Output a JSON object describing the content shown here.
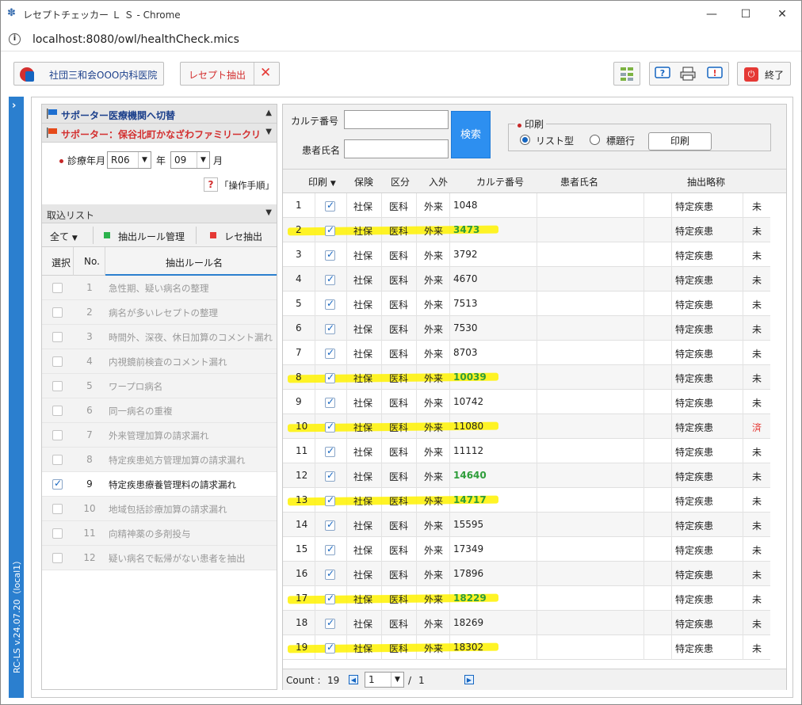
{
  "window": {
    "title": "レセプトチェッカー Ｌ Ｓ - Chrome",
    "url": "localhost:8080/owl/healthCheck.mics",
    "minimize": "—",
    "maximize": "☐",
    "close": "✕"
  },
  "toolbar": {
    "clinic_label": "社団三和会OOO内科医院",
    "extract_label": "レセプト抽出",
    "end_label": "終了"
  },
  "sidebar": {
    "version": "RC-LS v.24.07.20（local1）"
  },
  "left": {
    "supporter_switch": "サポーター医療機関へ切替",
    "supporter_name": "サポーター：保谷北町かなざわファミリークリ",
    "date_label": "診療年月",
    "year_value": "R06",
    "year_unit": "年",
    "month_value": "09",
    "month_unit": "月",
    "help_label": "「操作手順」",
    "import_list": "取込リスト",
    "all_label": "全て",
    "rule_manage": "抽出ルール管理",
    "rece_extract": "レセ抽出",
    "col_select": "選択",
    "col_no": "No.",
    "col_rule": "抽出ルール名",
    "rules": [
      {
        "no": "1",
        "name": "急性期、疑い病名の整理",
        "checked": false
      },
      {
        "no": "2",
        "name": "病名が多いレセプトの整理",
        "checked": false
      },
      {
        "no": "3",
        "name": "時間外、深夜、休日加算のコメント漏れ",
        "checked": false
      },
      {
        "no": "4",
        "name": "内視鏡前検査のコメント漏れ",
        "checked": false
      },
      {
        "no": "5",
        "name": "ワープロ病名",
        "checked": false
      },
      {
        "no": "6",
        "name": "同一病名の重複",
        "checked": false
      },
      {
        "no": "7",
        "name": "外来管理加算の請求漏れ",
        "checked": false
      },
      {
        "no": "8",
        "name": "特定疾患処方管理加算の請求漏れ",
        "checked": false
      },
      {
        "no": "9",
        "name": "特定疾患療養管理料の請求漏れ",
        "checked": true
      },
      {
        "no": "10",
        "name": "地域包括診療加算の請求漏れ",
        "checked": false
      },
      {
        "no": "11",
        "name": "向精神薬の多剤投与",
        "checked": false
      },
      {
        "no": "12",
        "name": "疑い病名で転帰がない患者を抽出",
        "checked": false
      }
    ]
  },
  "search": {
    "karte_label": "カルテ番号",
    "name_label": "患者氏名",
    "search_button": "検索",
    "print_legend": "印刷",
    "radio_list": "リスト型",
    "radio_title": "標題行",
    "print_button": "印刷"
  },
  "grid": {
    "headers": {
      "print": "印刷",
      "insurance": "保険",
      "category": "区分",
      "inout": "入外",
      "karte": "カルテ番号",
      "patient": "患者氏名",
      "summary": "抽出略称"
    },
    "rows": [
      {
        "idx": "1",
        "ins": "社保",
        "cat": "医科",
        "io": "外来",
        "karte": "1048",
        "summary": "特定疾患",
        "status": "未",
        "hl": false,
        "green": false,
        "red": false
      },
      {
        "idx": "2",
        "ins": "社保",
        "cat": "医科",
        "io": "外来",
        "karte": "3473",
        "summary": "特定疾患",
        "status": "未",
        "hl": true,
        "green": true,
        "red": false
      },
      {
        "idx": "3",
        "ins": "社保",
        "cat": "医科",
        "io": "外来",
        "karte": "3792",
        "summary": "特定疾患",
        "status": "未",
        "hl": false,
        "green": false,
        "red": false
      },
      {
        "idx": "4",
        "ins": "社保",
        "cat": "医科",
        "io": "外来",
        "karte": "4670",
        "summary": "特定疾患",
        "status": "未",
        "hl": false,
        "green": false,
        "red": false
      },
      {
        "idx": "5",
        "ins": "社保",
        "cat": "医科",
        "io": "外来",
        "karte": "7513",
        "summary": "特定疾患",
        "status": "未",
        "hl": false,
        "green": false,
        "red": false
      },
      {
        "idx": "6",
        "ins": "社保",
        "cat": "医科",
        "io": "外来",
        "karte": "7530",
        "summary": "特定疾患",
        "status": "未",
        "hl": false,
        "green": false,
        "red": false
      },
      {
        "idx": "7",
        "ins": "社保",
        "cat": "医科",
        "io": "外来",
        "karte": "8703",
        "summary": "特定疾患",
        "status": "未",
        "hl": false,
        "green": false,
        "red": false
      },
      {
        "idx": "8",
        "ins": "社保",
        "cat": "医科",
        "io": "外来",
        "karte": "10039",
        "summary": "特定疾患",
        "status": "未",
        "hl": true,
        "green": true,
        "red": false
      },
      {
        "idx": "9",
        "ins": "社保",
        "cat": "医科",
        "io": "外来",
        "karte": "10742",
        "summary": "特定疾患",
        "status": "未",
        "hl": false,
        "green": false,
        "red": false
      },
      {
        "idx": "10",
        "ins": "社保",
        "cat": "医科",
        "io": "外来",
        "karte": "11080",
        "summary": "特定疾患",
        "status": "済",
        "hl": true,
        "green": false,
        "red": true
      },
      {
        "idx": "11",
        "ins": "社保",
        "cat": "医科",
        "io": "外来",
        "karte": "11112",
        "summary": "特定疾患",
        "status": "未",
        "hl": false,
        "green": false,
        "red": false
      },
      {
        "idx": "12",
        "ins": "社保",
        "cat": "医科",
        "io": "外来",
        "karte": "14640",
        "summary": "特定疾患",
        "status": "未",
        "hl": false,
        "green": true,
        "red": false
      },
      {
        "idx": "13",
        "ins": "社保",
        "cat": "医科",
        "io": "外来",
        "karte": "14717",
        "summary": "特定疾患",
        "status": "未",
        "hl": true,
        "green": true,
        "red": false
      },
      {
        "idx": "14",
        "ins": "社保",
        "cat": "医科",
        "io": "外来",
        "karte": "15595",
        "summary": "特定疾患",
        "status": "未",
        "hl": false,
        "green": false,
        "red": false
      },
      {
        "idx": "15",
        "ins": "社保",
        "cat": "医科",
        "io": "外来",
        "karte": "17349",
        "summary": "特定疾患",
        "status": "未",
        "hl": false,
        "green": false,
        "red": false
      },
      {
        "idx": "16",
        "ins": "社保",
        "cat": "医科",
        "io": "外来",
        "karte": "17896",
        "summary": "特定疾患",
        "status": "未",
        "hl": false,
        "green": false,
        "red": false
      },
      {
        "idx": "17",
        "ins": "社保",
        "cat": "医科",
        "io": "外来",
        "karte": "18229",
        "summary": "特定疾患",
        "status": "未",
        "hl": true,
        "green": true,
        "red": false
      },
      {
        "idx": "18",
        "ins": "社保",
        "cat": "医科",
        "io": "外来",
        "karte": "18269",
        "summary": "特定疾患",
        "status": "未",
        "hl": false,
        "green": false,
        "red": false
      },
      {
        "idx": "19",
        "ins": "社保",
        "cat": "医科",
        "io": "外来",
        "karte": "18302",
        "summary": "特定疾患",
        "status": "未",
        "hl": true,
        "green": false,
        "red": false
      }
    ],
    "footer": {
      "count_label": "Count :",
      "count_value": "19",
      "page_value": "1",
      "page_sep": "/",
      "page_total": "1"
    }
  },
  "colors": {
    "accent_blue": "#2b7fcf",
    "search_button": "#2d8ff0",
    "highlight": "#fff200",
    "done_red": "#e53935",
    "karte_green": "#2e9d3a"
  }
}
